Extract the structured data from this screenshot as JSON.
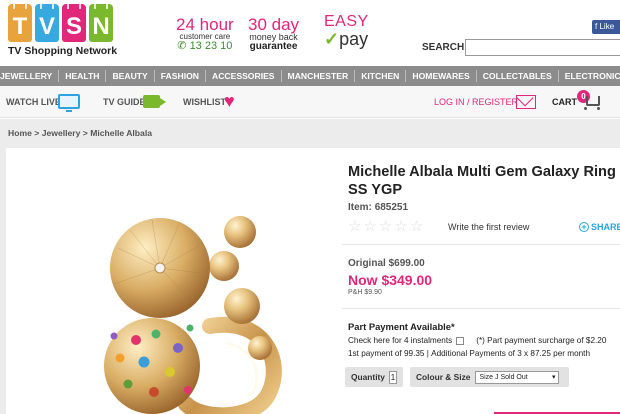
{
  "brand": {
    "letters": [
      "T",
      "V",
      "S",
      "N"
    ],
    "letter_colors": [
      "#e8a33d",
      "#38a9e0",
      "#e0277a",
      "#7ab82e"
    ],
    "tagline": "TV Shopping Network"
  },
  "promos": {
    "support": {
      "big": "24",
      "big_unit": "hour",
      "small": "customer care",
      "phone": "13 23 10"
    },
    "returns": {
      "big": "30 day",
      "small": "money back",
      "bold": "guarantee"
    },
    "easypay": {
      "top": "EASY",
      "bottom": "pay"
    }
  },
  "search": {
    "label": "SEARCH:",
    "placeholder": ""
  },
  "facebook": {
    "label": "Like"
  },
  "categories": [
    "JEWELLERY",
    "HEALTH",
    "BEAUTY",
    "FASHION",
    "ACCESSORIES",
    "MANCHESTER",
    "KITCHEN",
    "HOMEWARES",
    "COLLECTABLES",
    "ELECTRONICS"
  ],
  "utility": {
    "watch_live": "WATCH LIVE",
    "tv_guide": "TV GUIDE",
    "wishlist": "WISHLIST",
    "login": "LOG IN / REGISTER",
    "cart": "CART",
    "cart_count": "0"
  },
  "breadcrumb": {
    "home": "Home",
    "sep": ">",
    "category": "Jewellery",
    "brand": "Michelle Albala"
  },
  "product": {
    "title": "Michelle Albala Multi Gem Galaxy Ring SS YGP",
    "item_label": "Item:",
    "item_number": "685251",
    "rating": 0,
    "rating_max": 5,
    "review_link": "Write the first review",
    "share_label": "SHARE",
    "original_label": "Original",
    "original_price": "$699.00",
    "now_label": "Now",
    "now_price": "$349.00",
    "ph_label": "P&H",
    "ph_price": "$9.90"
  },
  "part_payment": {
    "title": "Part Payment Available*",
    "check_label": "Check here for 4 instalments",
    "surcharge_note": "(*) Part payment surcharge of $2.20",
    "first_payment": "1st payment of 99.35",
    "sep": "|",
    "additional": "Additional Payments of 3 x 87.25 per month"
  },
  "options": {
    "quantity_label": "Quantity",
    "quantity_value": "1",
    "size_label": "Colour & Size",
    "size_value": "Size J Sold Out"
  }
}
